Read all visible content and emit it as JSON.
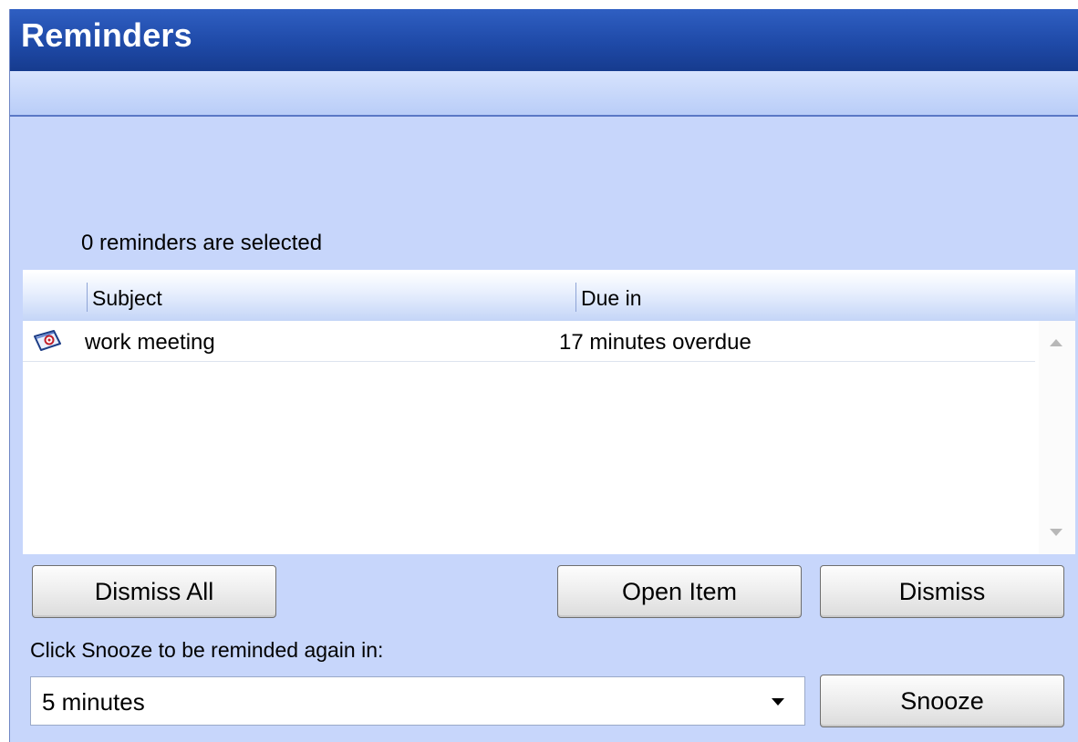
{
  "window": {
    "title": "Reminders"
  },
  "status": {
    "selected_count_text": "0 reminders are selected"
  },
  "list": {
    "columns": [
      "Subject",
      "Due in"
    ],
    "rows": [
      {
        "icon": "appointment-icon",
        "subject": "work meeting",
        "due": "17 minutes overdue"
      }
    ]
  },
  "buttons": {
    "dismiss_all": "Dismiss All",
    "open_item": "Open Item",
    "dismiss": "Dismiss",
    "snooze": "Snooze"
  },
  "snooze": {
    "prompt": "Click Snooze to be reminded again in:",
    "selected_value": "5 minutes"
  },
  "colors": {
    "titlebar": "#1f4aa8",
    "background": "#c7d6fb",
    "list_background": "#ffffff"
  }
}
